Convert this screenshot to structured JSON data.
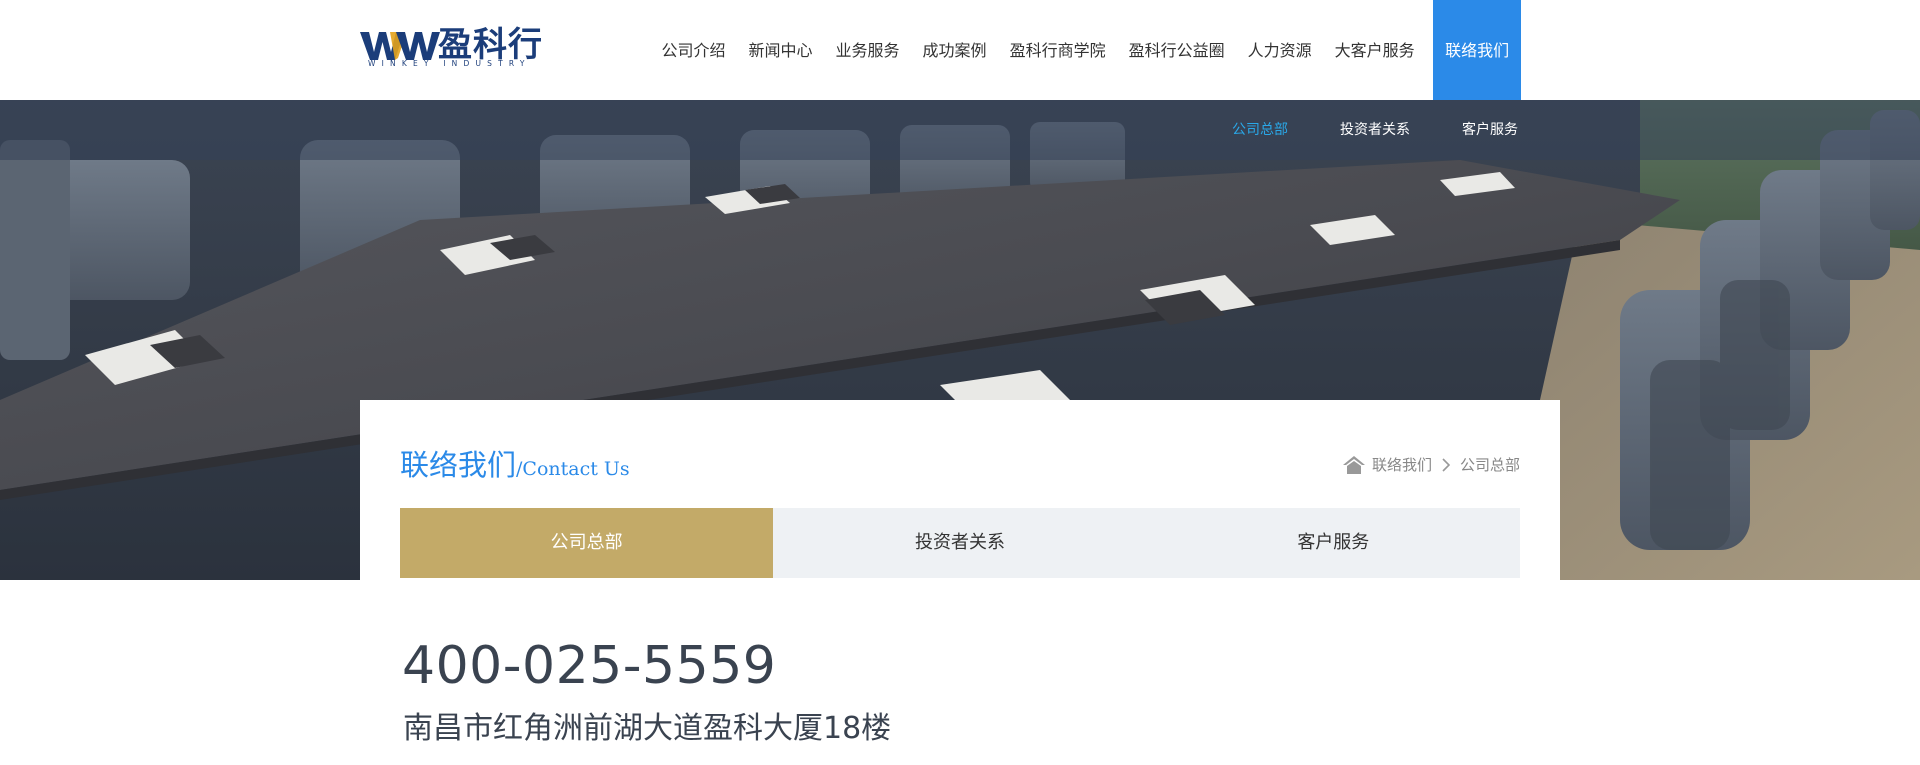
{
  "logo": {
    "mark": "WW",
    "name_cn": "盈科行",
    "name_en": "WINKEY INDUSTRY"
  },
  "nav": {
    "items": [
      {
        "label": "公司介绍"
      },
      {
        "label": "新闻中心"
      },
      {
        "label": "业务服务"
      },
      {
        "label": "成功案例"
      },
      {
        "label": "盈科行商学院"
      },
      {
        "label": "盈科行公益圈"
      },
      {
        "label": "人力资源"
      },
      {
        "label": "大客户服务"
      },
      {
        "label": "联络我们"
      }
    ],
    "active": "联络我们"
  },
  "subnav": {
    "items": [
      {
        "label": "公司总部"
      },
      {
        "label": "投资者关系"
      },
      {
        "label": "客户服务"
      }
    ],
    "active": "公司总部"
  },
  "section": {
    "title_cn": "联络我们",
    "title_en": "/Contact  Us"
  },
  "breadcrumb": {
    "items": [
      {
        "label": "联络我们"
      },
      {
        "label": "公司总部"
      }
    ]
  },
  "tabs": {
    "items": [
      {
        "label": "公司总部"
      },
      {
        "label": "投资者关系"
      },
      {
        "label": "客户服务"
      }
    ],
    "active": "公司总部"
  },
  "contact": {
    "phone": "400-025-5559",
    "address": "南昌市红角洲前湖大道盈科大厦18楼"
  },
  "colors": {
    "brand_blue": "#2b8ae8",
    "logo_navy": "#1b3d7a",
    "logo_gold": "#e3a21b",
    "tab_active_gold": "#c3aa68",
    "subnav_active": "#2aa8e8"
  },
  "icons": {
    "home": "home-icon",
    "breadcrumb_separator": "chevron-right-icon"
  }
}
